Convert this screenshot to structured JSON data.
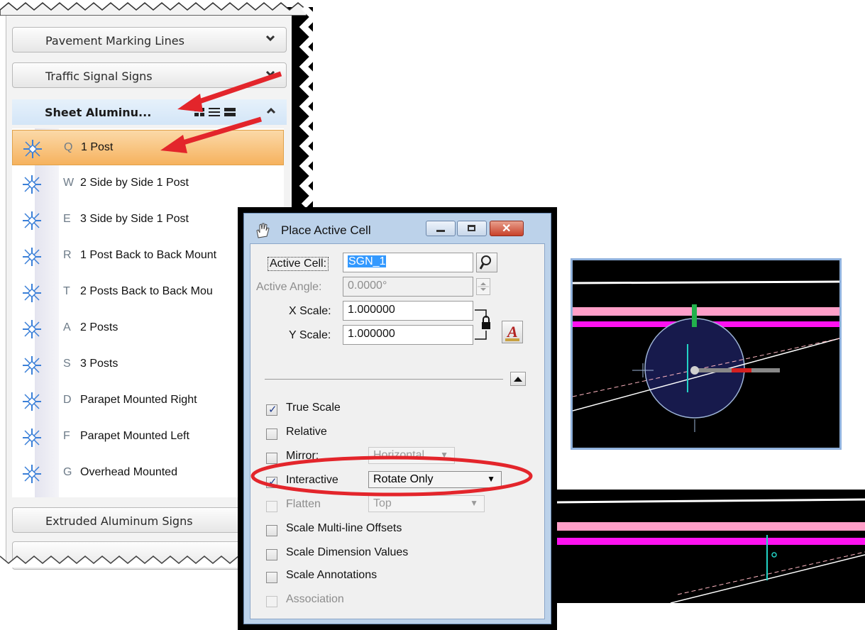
{
  "panel": {
    "groups_top": [
      {
        "label": "Pavement Marking Lines"
      },
      {
        "label": "Traffic Signal Signs"
      }
    ],
    "active_group": {
      "label": "Sheet Aluminu..."
    },
    "tools": [
      {
        "key": "Q",
        "label": "1 Post",
        "selected": true
      },
      {
        "key": "W",
        "label": "2 Side by Side 1 Post"
      },
      {
        "key": "E",
        "label": "3 Side by Side 1 Post"
      },
      {
        "key": "R",
        "label": "1 Post Back to Back Mount"
      },
      {
        "key": "T",
        "label": "2 Posts Back to Back Mou"
      },
      {
        "key": "A",
        "label": "2 Posts"
      },
      {
        "key": "S",
        "label": "3 Posts"
      },
      {
        "key": "D",
        "label": "Parapet Mounted Right"
      },
      {
        "key": "F",
        "label": "Parapet Mounted Left"
      },
      {
        "key": "G",
        "label": "Overhead Mounted"
      }
    ],
    "groups_bottom": [
      {
        "label": "Extruded Aluminum Signs"
      }
    ]
  },
  "dialog": {
    "title": "Place Active Cell",
    "active_cell_label": "Active Cell:",
    "active_cell_value": "SGN_1",
    "active_angle_label": "Active Angle:",
    "active_angle_value": "0.0000°",
    "x_scale_label": "X Scale:",
    "x_scale_value": "1.000000",
    "y_scale_label": "Y Scale:",
    "y_scale_value": "1.000000",
    "options": {
      "true_scale": {
        "label": "True Scale",
        "checked": true
      },
      "relative": {
        "label": "Relative",
        "checked": false
      },
      "mirror": {
        "label": "Mirror:",
        "checked": false,
        "disabled": true,
        "value": "Horizontal"
      },
      "interactive": {
        "label": "Interactive",
        "checked": true,
        "value": "Rotate Only"
      },
      "flatten": {
        "label": "Flatten",
        "checked": false,
        "disabled": true,
        "value": "Top"
      },
      "scale_multiline": {
        "label": "Scale Multi-line Offsets",
        "checked": false
      },
      "scale_dimension": {
        "label": "Scale Dimension Values",
        "checked": false
      },
      "scale_annotations": {
        "label": "Scale Annotations",
        "checked": false
      },
      "association": {
        "label": "Association",
        "checked": false,
        "disabled": true
      }
    }
  },
  "colors": {
    "highlight_red": "#e3252b",
    "selection_orange": "#f6b25e",
    "cad_pink": "#ff9fc8",
    "cad_magenta": "#ff12f0"
  }
}
